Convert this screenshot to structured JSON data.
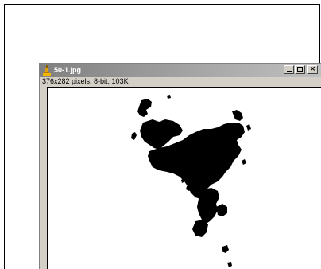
{
  "window": {
    "title": "50-1.jpg",
    "info": "376x282 pixels; 8-bit; 103K",
    "controls": {
      "minimize": "_",
      "maximize": "□",
      "close": "×"
    }
  },
  "icons": {
    "app": "imagej-microscope-icon",
    "minimize": "minimize-icon",
    "maximize": "maximize-icon",
    "close": "close-icon"
  },
  "colors": {
    "titlebar": "#808080",
    "window_face": "#d4d0c8",
    "image_bg": "#ffffff",
    "blob": "#000000"
  }
}
